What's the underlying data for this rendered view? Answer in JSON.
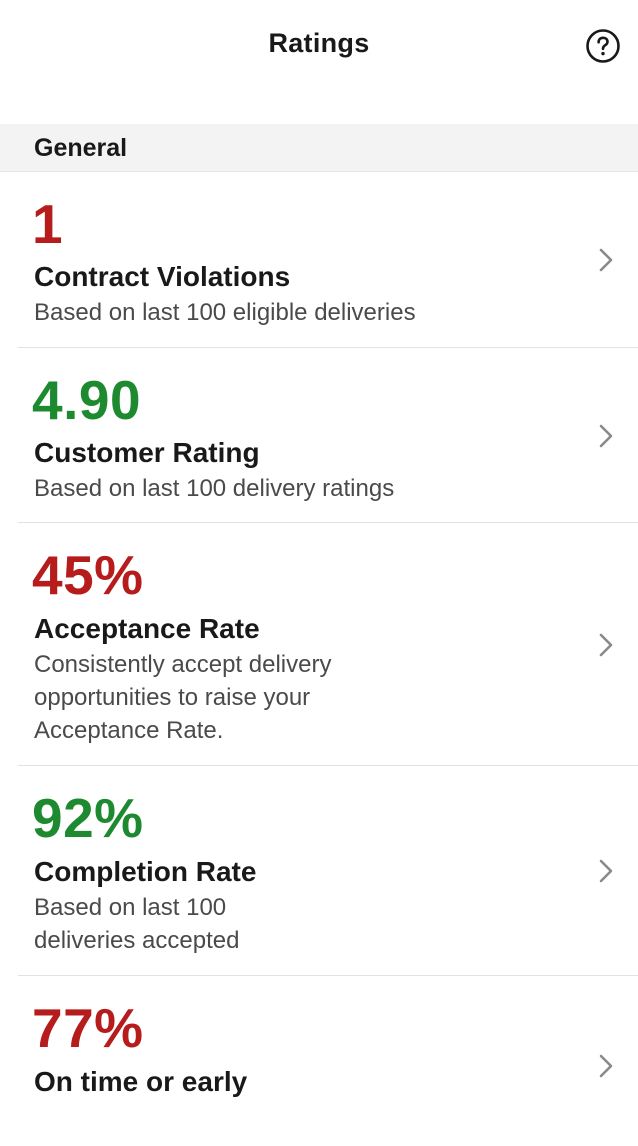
{
  "header": {
    "title": "Ratings",
    "help_icon": "question-circle-icon"
  },
  "section": {
    "label": "General"
  },
  "rows": [
    {
      "value": "1",
      "value_color": "#b71c1c",
      "title": "Contract Violations",
      "subtitle": "Based on last 100 eligible deliveries"
    },
    {
      "value": "4.90",
      "value_color": "#1e8a2f",
      "title": "Customer Rating",
      "subtitle": "Based on last 100 delivery ratings"
    },
    {
      "value": "45%",
      "value_color": "#b71c1c",
      "title": "Acceptance Rate",
      "subtitle_lines": [
        "Consistently accept delivery",
        "opportunities to raise your",
        "Acceptance Rate."
      ]
    },
    {
      "value": "92%",
      "value_color": "#1e8a2f",
      "title": "Completion Rate",
      "subtitle_lines": [
        "Based on last 100",
        "deliveries accepted"
      ]
    },
    {
      "value": "77%",
      "value_color": "#b71c1c",
      "title": "On time or early"
    }
  ]
}
